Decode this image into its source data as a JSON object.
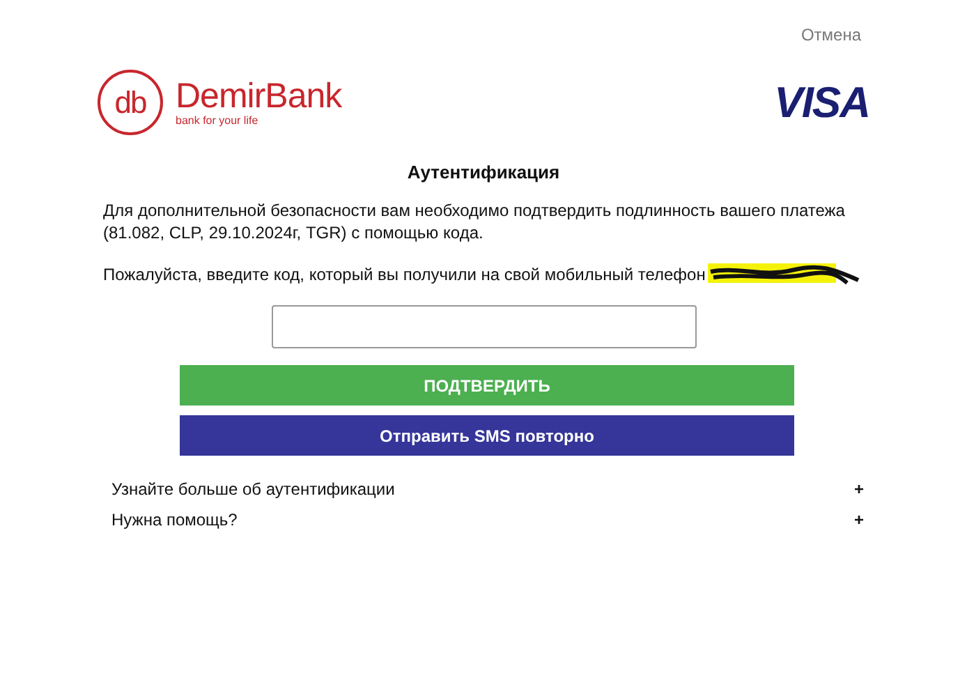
{
  "cancel": "Отмена",
  "bank_logo": {
    "mark": "db",
    "name": "DemirBank",
    "slogan": "bank for your life"
  },
  "card_logo": "VISA",
  "title": "Аутентификация",
  "info": "Для дополнительной безопасности вам необходимо подтвердить подлинность вашего платежа (81.082, CLP, 29.10.2024г, TGR) с помощью кода.",
  "prompt": "Пожалуйста, введите код, который вы получили на свой мобильный телефон",
  "buttons": [
    {
      "kind": "primary",
      "label": "ПОДТВЕРДИТЬ"
    },
    {
      "kind": "secondary",
      "label": "Отправить SMS повторно"
    }
  ],
  "sections": [
    {
      "label": "Узнайте больше об аутентификации",
      "toggle": "+",
      "expanded": false
    },
    {
      "label": "Нужна помощь?",
      "toggle": "+",
      "expanded": false
    }
  ]
}
